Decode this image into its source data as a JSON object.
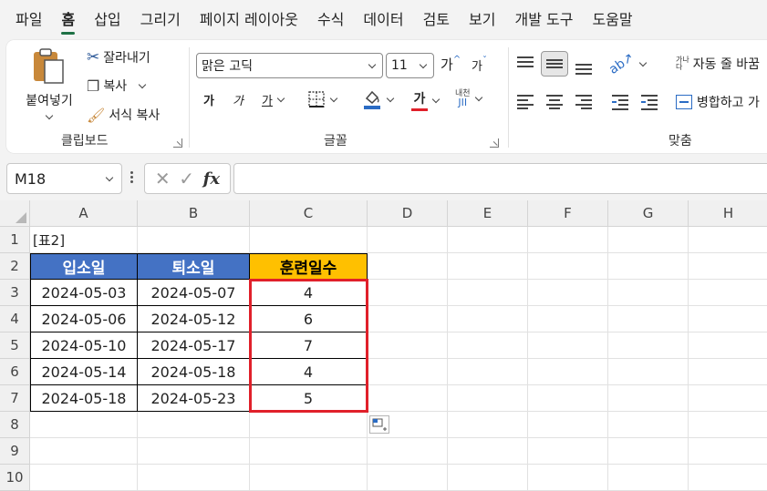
{
  "menu": {
    "items": [
      "파일",
      "홈",
      "삽입",
      "그리기",
      "페이지 레이아웃",
      "수식",
      "데이터",
      "검토",
      "보기",
      "개발 도구",
      "도움말"
    ],
    "active_index": 1
  },
  "ribbon": {
    "clipboard": {
      "paste_label": "붙여넣기",
      "cut_label": "잘라내기",
      "copy_label": "복사",
      "format_painter_label": "서식 복사",
      "group_label": "클립보드"
    },
    "font": {
      "font_name": "맑은 고딕",
      "font_size": "11",
      "grow_label": "가",
      "shrink_label": "가",
      "bold_label": "가",
      "italic_label": "가",
      "underline_label": "가",
      "font_color_label": "가",
      "phonetic_label": "내천",
      "group_label": "글꼴"
    },
    "alignment": {
      "wrap_text_label": "자동 줄 바꿈",
      "merge_label": "병합하고 가",
      "wrap_icon_text": "가나\n다",
      "group_label": "맞춤"
    }
  },
  "formula_bar": {
    "name_box": "M18",
    "cancel_glyph": "✕",
    "confirm_glyph": "✓",
    "fx_label": "fx",
    "formula": ""
  },
  "sheet": {
    "columns": [
      "A",
      "B",
      "C",
      "D",
      "E",
      "F",
      "G",
      "H"
    ],
    "rows": [
      "1",
      "2",
      "3",
      "4",
      "5",
      "6",
      "7",
      "8",
      "9",
      "10"
    ],
    "title_cell": "[표2]",
    "table_headers": [
      "입소일",
      "퇴소일",
      "훈련일수"
    ],
    "table_rows": [
      [
        "2024-05-03",
        "2024-05-07",
        "4"
      ],
      [
        "2024-05-06",
        "2024-05-12",
        "6"
      ],
      [
        "2024-05-10",
        "2024-05-17",
        "7"
      ],
      [
        "2024-05-14",
        "2024-05-18",
        "4"
      ],
      [
        "2024-05-18",
        "2024-05-23",
        "5"
      ]
    ]
  },
  "colors": {
    "header_blue": "#4472c4",
    "header_gold": "#ffc000",
    "selection_red": "#e0202a",
    "tab_accent": "#1e7145"
  }
}
